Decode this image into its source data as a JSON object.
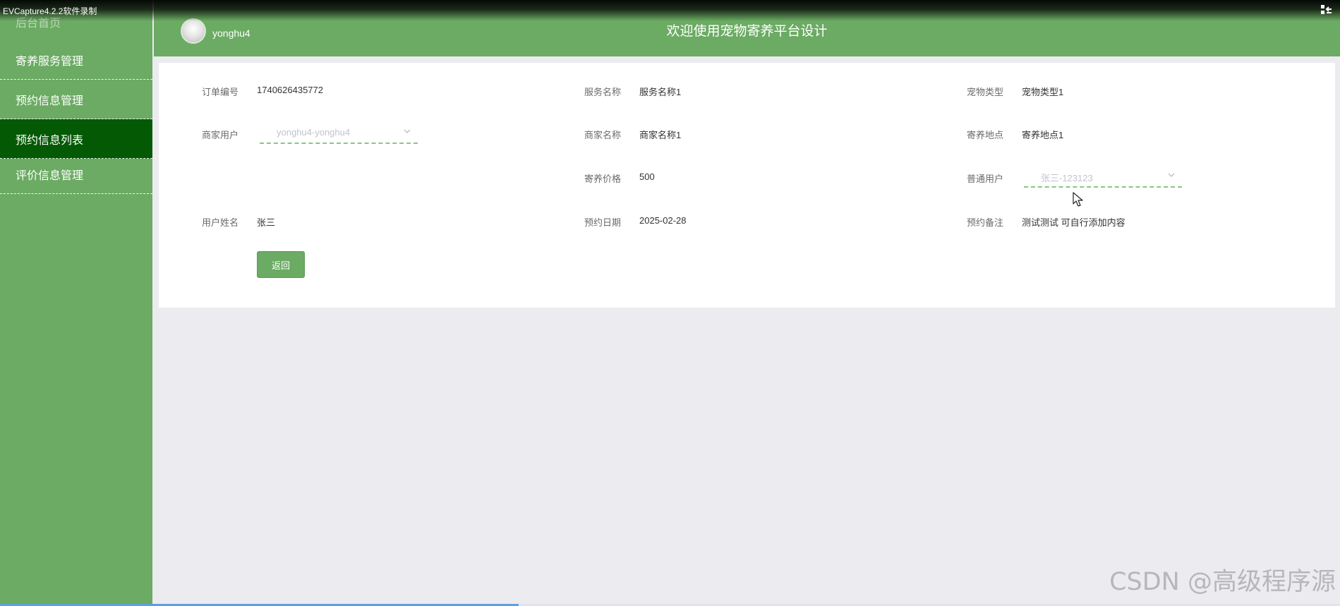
{
  "recorder": {
    "title": "EVCapture4.2.2软件录制"
  },
  "sidebar": {
    "home": "后台首页",
    "items": [
      {
        "label": "寄养服务管理"
      },
      {
        "label": "预约信息管理"
      },
      {
        "label": "预约信息列表"
      },
      {
        "label": "评价信息管理"
      }
    ],
    "active_index": 2
  },
  "header": {
    "username": "yonghu4",
    "title": "欢迎使用宠物寄养平台设计"
  },
  "form": {
    "order_no": {
      "label": "订单编号",
      "value": "1740626435772"
    },
    "service_name": {
      "label": "服务名称",
      "value": "服务名称1"
    },
    "pet_type": {
      "label": "宠物类型",
      "value": "宠物类型1"
    },
    "merchant_user": {
      "label": "商家用户",
      "value": "yonghu4-yonghu4"
    },
    "merchant_name": {
      "label": "商家名称",
      "value": "商家名称1"
    },
    "location": {
      "label": "寄养地点",
      "value": "寄养地点1"
    },
    "price": {
      "label": "寄养价格",
      "value": "500"
    },
    "normal_user": {
      "label": "普通用户",
      "value": "张三-123123"
    },
    "user_name": {
      "label": "用户姓名",
      "value": "张三"
    },
    "date": {
      "label": "预约日期",
      "value": "2025-02-28"
    },
    "remark": {
      "label": "预约备注",
      "value": "测试测试 可自行添加内容"
    },
    "back_button": "返回"
  },
  "watermark": "CSDN @高级程序源",
  "colors": {
    "sidebar": "#6bab63",
    "active_menu": "#045a04",
    "background": "#ecebf0",
    "select_underline": "#8cc584"
  }
}
